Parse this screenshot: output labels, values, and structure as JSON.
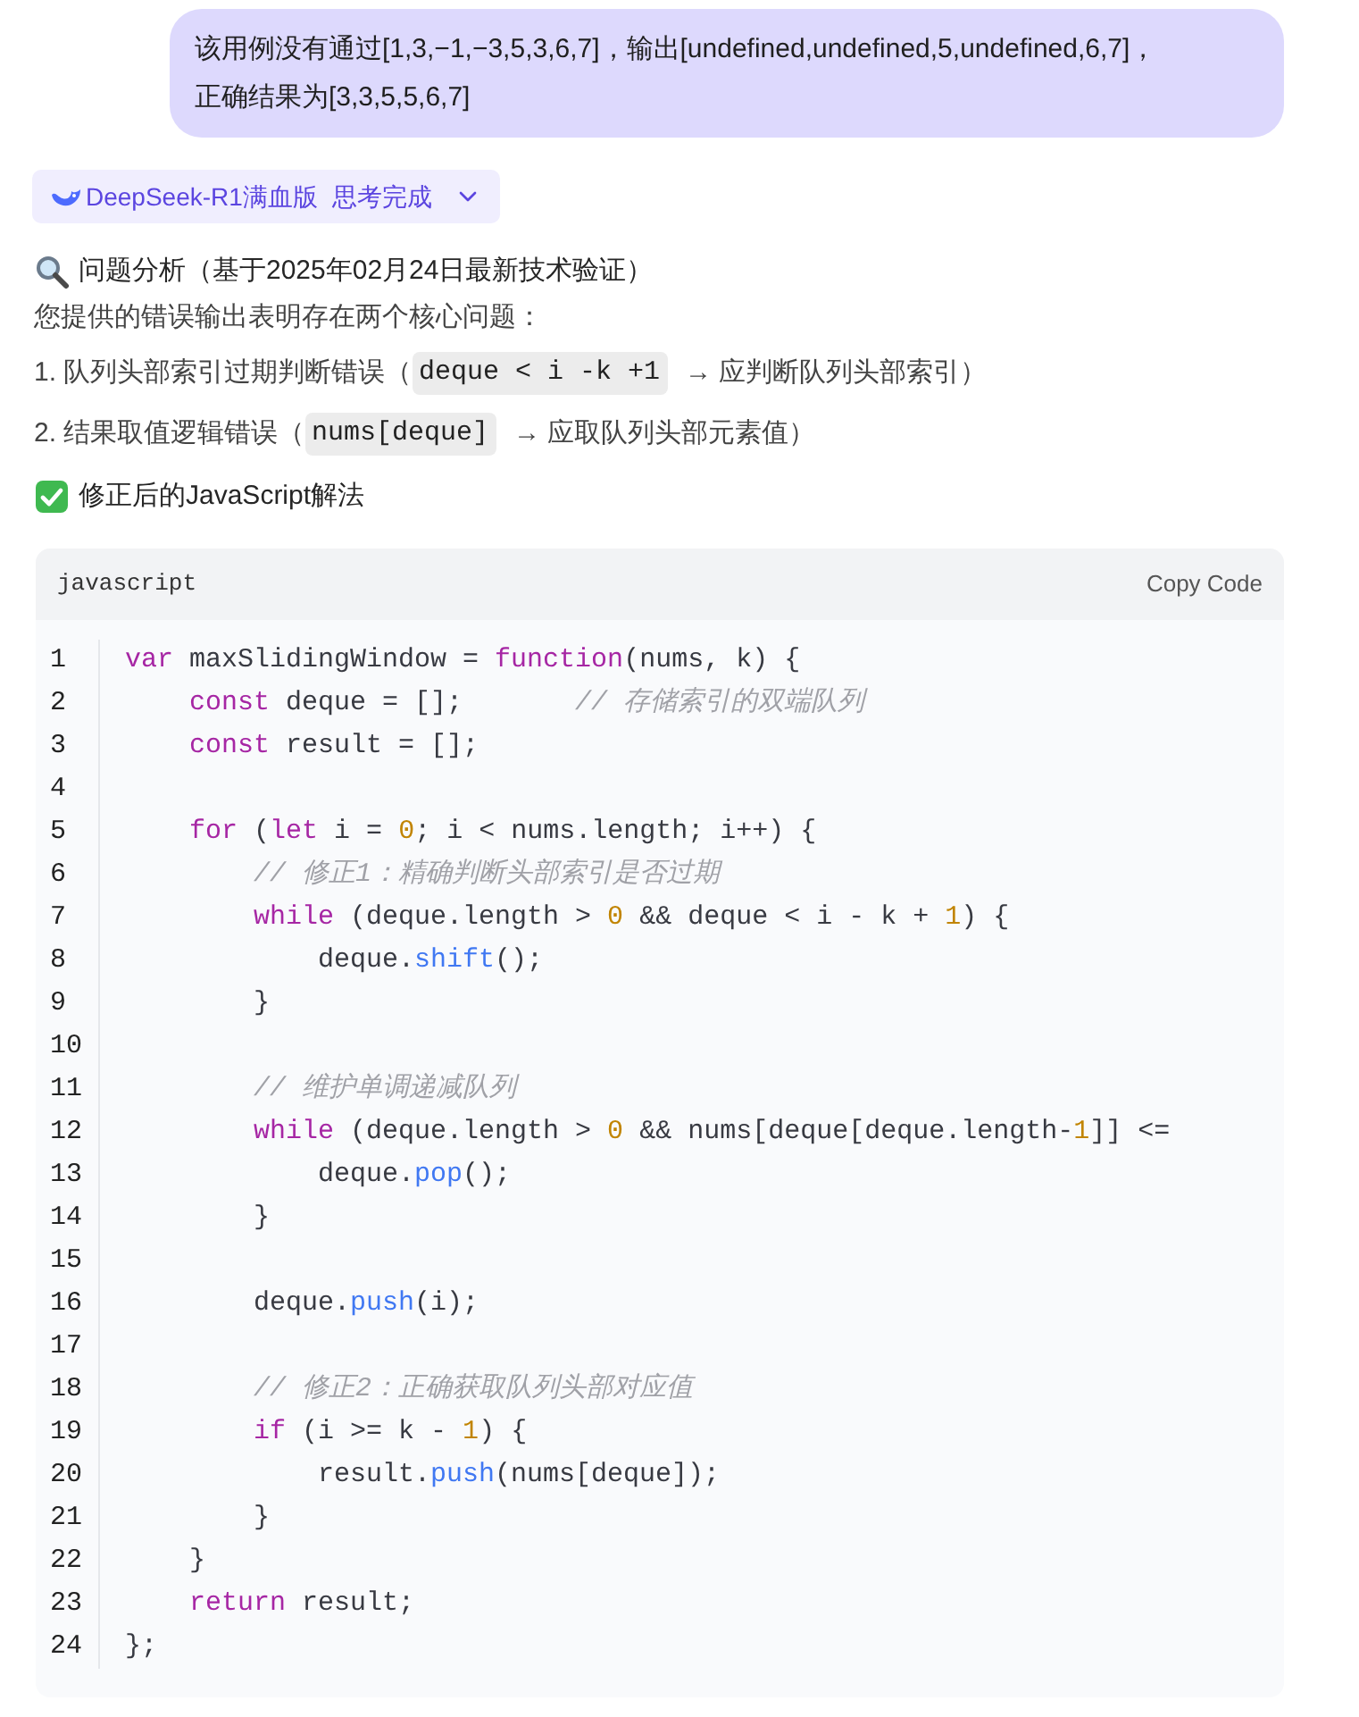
{
  "user_message": {
    "lines": [
      "该用例没有通过[1,3,−1,−3,5,3,6,7]，输出[undefined,undefined,5,undefined,6,7]，",
      "正确结果为[3,3,5,5,6,7]"
    ]
  },
  "model_badge": {
    "model": "DeepSeek-R1满血版",
    "status": "思考完成",
    "expanded": false
  },
  "answer": {
    "analysis_heading": "问题分析（基于2025年02月24日最新技术验证）",
    "intro": "您提供的错误输出表明存在两个核心问题：",
    "issues": [
      {
        "number": "1.",
        "text": "队列头部索引过期判断错误（",
        "code": "deque < i -k +1",
        "after": "→ 应判断队列头部索引）"
      },
      {
        "number": "2.",
        "text": "结果取值逻辑错误（",
        "code": "nums[deque]",
        "after": "→ 应取队列头部元素值）"
      }
    ],
    "solution_heading": "修正后的JavaScript解法"
  },
  "code_block": {
    "language": "javascript",
    "copy_label": "Copy Code",
    "lines": [
      {
        "number": "1",
        "kind": "top",
        "tokens": [
          {
            "t": "var",
            "kind": "keyword"
          },
          {
            "t": " maxSlidingWindow = ",
            "kind": "plain"
          },
          {
            "t": "function",
            "kind": "keyword"
          },
          {
            "t": "(nums, k) {",
            "kind": "plain"
          }
        ]
      },
      {
        "number": "2",
        "kind": "inner",
        "tokens": [
          {
            "t": "const",
            "kind": "keyword"
          },
          {
            "t": " deque = [];       ",
            "kind": "plain"
          },
          {
            "t": "// 存储索引的双端队列",
            "kind": "comment"
          }
        ]
      },
      {
        "number": "3",
        "kind": "inner",
        "tokens": [
          {
            "t": "const",
            "kind": "keyword"
          },
          {
            "t": " result = [];",
            "kind": "plain"
          }
        ]
      },
      {
        "number": "4",
        "kind": "top"
      },
      {
        "number": "5",
        "kind": "inner",
        "tokens": [
          {
            "t": "for",
            "kind": "keyword"
          },
          {
            "t": " (",
            "kind": "plain"
          },
          {
            "t": "let",
            "kind": "keyword"
          },
          {
            "t": " i = ",
            "kind": "plain"
          },
          {
            "t": "0",
            "kind": "number"
          },
          {
            "t": "; i < nums.length; i++) {",
            "kind": "plain"
          }
        ]
      },
      {
        "number": "6",
        "kind": "nested",
        "tokens": [
          {
            "t": "// 修正1：精确判断头部索引是否过期",
            "kind": "comment"
          }
        ]
      },
      {
        "number": "7",
        "kind": "nested",
        "tokens": [
          {
            "t": "while",
            "kind": "keyword"
          },
          {
            "t": " (deque.length > ",
            "kind": "plain"
          },
          {
            "t": "0",
            "kind": "number"
          },
          {
            "t": " && deque < i - k + ",
            "kind": "plain"
          },
          {
            "t": "1",
            "kind": "number"
          },
          {
            "t": ") {",
            "kind": "plain"
          }
        ]
      },
      {
        "number": "8",
        "kind": "deep",
        "tokens": [
          {
            "t": "deque.",
            "kind": "plain"
          },
          {
            "t": "shift",
            "kind": "function"
          },
          {
            "t": "();",
            "kind": "plain"
          }
        ]
      },
      {
        "number": "9",
        "kind": "nested",
        "tokens": [
          {
            "t": "}",
            "kind": "plain"
          }
        ]
      },
      {
        "number": "10",
        "kind": "top"
      },
      {
        "number": "11",
        "kind": "nested",
        "tokens": [
          {
            "t": "// 维护单调递减队列",
            "kind": "comment"
          }
        ]
      },
      {
        "number": "12",
        "kind": "nested",
        "tokens": [
          {
            "t": "while",
            "kind": "keyword"
          },
          {
            "t": " (deque.length > ",
            "kind": "plain"
          },
          {
            "t": "0",
            "kind": "number"
          },
          {
            "t": " && nums[deque[deque.length-",
            "kind": "plain"
          },
          {
            "t": "1",
            "kind": "number"
          },
          {
            "t": "]] <=",
            "kind": "plain"
          }
        ]
      },
      {
        "number": "13",
        "kind": "deep",
        "tokens": [
          {
            "t": "deque.",
            "kind": "plain"
          },
          {
            "t": "pop",
            "kind": "function"
          },
          {
            "t": "();",
            "kind": "plain"
          }
        ]
      },
      {
        "number": "14",
        "kind": "nested",
        "tokens": [
          {
            "t": "}",
            "kind": "plain"
          }
        ]
      },
      {
        "number": "15",
        "kind": "top"
      },
      {
        "number": "16",
        "kind": "nested",
        "tokens": [
          {
            "t": "deque.",
            "kind": "plain"
          },
          {
            "t": "push",
            "kind": "function"
          },
          {
            "t": "(i);",
            "kind": "plain"
          }
        ]
      },
      {
        "number": "17",
        "kind": "top"
      },
      {
        "number": "18",
        "kind": "nested",
        "tokens": [
          {
            "t": "// 修正2：正确获取队列头部对应值",
            "kind": "comment"
          }
        ]
      },
      {
        "number": "19",
        "kind": "nested",
        "tokens": [
          {
            "t": "if",
            "kind": "keyword"
          },
          {
            "t": " (i >= k - ",
            "kind": "plain"
          },
          {
            "t": "1",
            "kind": "number"
          },
          {
            "t": ") {",
            "kind": "plain"
          }
        ]
      },
      {
        "number": "20",
        "kind": "deep",
        "tokens": [
          {
            "t": "result.",
            "kind": "plain"
          },
          {
            "t": "push",
            "kind": "function"
          },
          {
            "t": "(nums[deque]);",
            "kind": "plain"
          }
        ]
      },
      {
        "number": "21",
        "kind": "nested",
        "tokens": [
          {
            "t": "}",
            "kind": "plain"
          }
        ]
      },
      {
        "number": "22",
        "kind": "inner",
        "tokens": [
          {
            "t": "}",
            "kind": "plain"
          }
        ]
      },
      {
        "number": "23",
        "kind": "inner",
        "tokens": [
          {
            "t": "return",
            "kind": "keyword"
          },
          {
            "t": " result;",
            "kind": "plain"
          }
        ]
      },
      {
        "number": "24",
        "kind": "top",
        "tokens": [
          {
            "t": "};",
            "kind": "plain"
          }
        ]
      }
    ]
  }
}
